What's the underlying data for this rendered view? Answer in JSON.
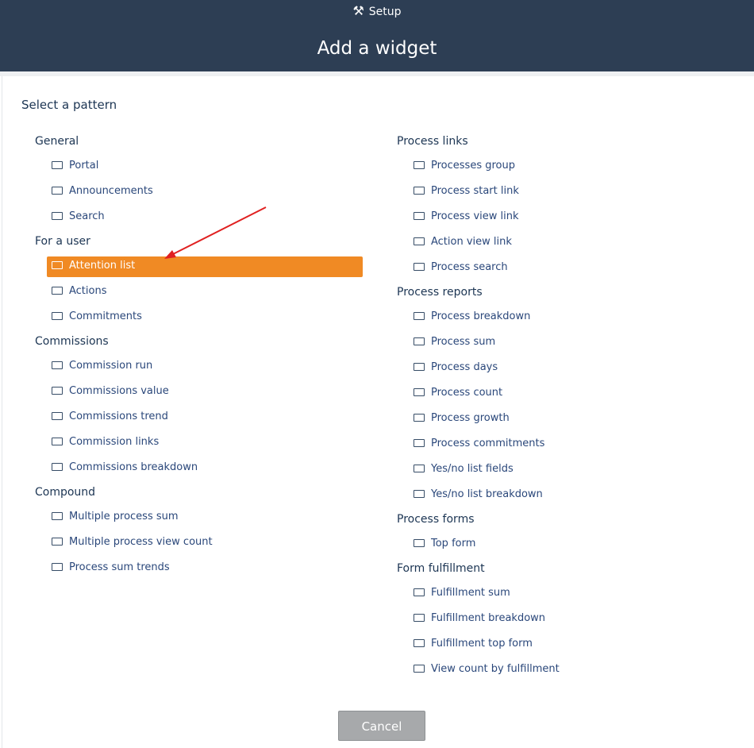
{
  "header": {
    "setup_icon": "tools-icon",
    "setup_label": "Setup",
    "title": "Add a widget"
  },
  "select_pattern": "Select a pattern",
  "left_groups": [
    {
      "label": "General",
      "items": [
        "Portal",
        "Announcements",
        "Search"
      ]
    },
    {
      "label": "For a user",
      "items": [
        "Attention list",
        "Actions",
        "Commitments"
      ]
    },
    {
      "label": "Commissions",
      "items": [
        "Commission run",
        "Commissions value",
        "Commissions trend",
        "Commission links",
        "Commissions breakdown"
      ]
    },
    {
      "label": "Compound",
      "items": [
        "Multiple process sum",
        "Multiple process view count",
        "Process sum trends"
      ]
    }
  ],
  "right_groups": [
    {
      "label": "Process links",
      "items": [
        "Processes group",
        "Process start link",
        "Process view link",
        "Action view link",
        "Process search"
      ]
    },
    {
      "label": "Process reports",
      "items": [
        "Process breakdown",
        "Process sum",
        "Process days",
        "Process count",
        "Process growth",
        "Process commitments",
        "Yes/no list fields",
        "Yes/no list breakdown"
      ]
    },
    {
      "label": "Process forms",
      "items": [
        "Top form"
      ]
    },
    {
      "label": "Form fulfillment",
      "items": [
        "Fulfillment sum",
        "Fulfillment breakdown",
        "Fulfillment top form",
        "View count by fulfillment"
      ]
    }
  ],
  "selected_item": "Attention list",
  "cancel_label": "Cancel",
  "colors": {
    "header_bg": "#2d3e54",
    "highlight": "#f08a24",
    "annotation_arrow": "#e02020"
  }
}
